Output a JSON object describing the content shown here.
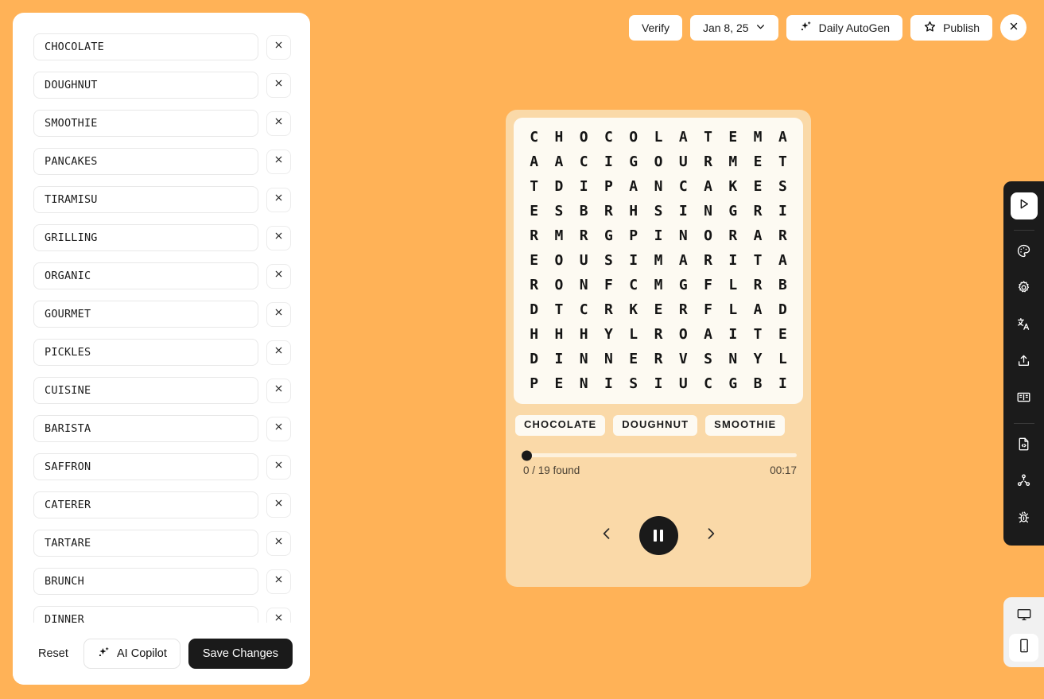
{
  "app": {
    "background_color": "#ffb257",
    "card_color": "#fad9a8",
    "panel_color": "#fdfaf2",
    "accent_dark": "#1a1a1a"
  },
  "toolbar": {
    "verify_label": "Verify",
    "date_label": "Jan 8, 25",
    "date_caret_icon": "chevron-down-icon",
    "autogen_label": "Daily AutoGen",
    "autogen_icon": "sparkle-icon",
    "publish_label": "Publish",
    "publish_icon": "star-icon",
    "close_icon": "close-icon"
  },
  "sidebar": {
    "words": [
      "CHOCOLATE",
      "DOUGHNUT",
      "SMOOTHIE",
      "PANCAKES",
      "TIRAMISU",
      "GRILLING",
      "ORGANIC",
      "GOURMET",
      "PICKLES",
      "CUISINE",
      "BARISTA",
      "SAFFRON",
      "CATERER",
      "TARTARE",
      "BRUNCH",
      "DINNER"
    ],
    "delete_icon": "close-icon",
    "footer": {
      "reset_label": "Reset",
      "copilot_label": "AI Copilot",
      "copilot_icon": "sparkle-icon",
      "save_label": "Save Changes"
    }
  },
  "puzzle": {
    "grid": [
      [
        "C",
        "H",
        "O",
        "C",
        "O",
        "L",
        "A",
        "T",
        "E",
        "M",
        "A"
      ],
      [
        "A",
        "A",
        "C",
        "I",
        "G",
        "O",
        "U",
        "R",
        "M",
        "E",
        "T"
      ],
      [
        "T",
        "D",
        "I",
        "P",
        "A",
        "N",
        "C",
        "A",
        "K",
        "E",
        "S"
      ],
      [
        "E",
        "S",
        "B",
        "R",
        "H",
        "S",
        "I",
        "N",
        "G",
        "R",
        "I"
      ],
      [
        "R",
        "M",
        "R",
        "G",
        "P",
        "I",
        "N",
        "O",
        "R",
        "A",
        "R"
      ],
      [
        "E",
        "O",
        "U",
        "S",
        "I",
        "M",
        "A",
        "R",
        "I",
        "T",
        "A"
      ],
      [
        "R",
        "O",
        "N",
        "F",
        "C",
        "M",
        "G",
        "F",
        "L",
        "R",
        "B"
      ],
      [
        "D",
        "T",
        "C",
        "R",
        "K",
        "E",
        "R",
        "F",
        "L",
        "A",
        "D"
      ],
      [
        "H",
        "H",
        "H",
        "Y",
        "L",
        "R",
        "O",
        "A",
        "I",
        "T",
        "E"
      ],
      [
        "D",
        "I",
        "N",
        "N",
        "E",
        "R",
        "V",
        "S",
        "N",
        "Y",
        "L"
      ],
      [
        "P",
        "E",
        "N",
        "I",
        "S",
        "I",
        "U",
        "C",
        "G",
        "B",
        "I"
      ]
    ],
    "chips": [
      "CHOCOLATE",
      "DOUGHNUT",
      "SMOOTHIE"
    ],
    "progress": {
      "percent": 0,
      "found_label": "0 / 19 found",
      "timer_label": "00:17"
    },
    "controls": {
      "prev_icon": "chevron-left-icon",
      "play_state_icon": "pause-icon",
      "next_icon": "chevron-right-icon"
    }
  },
  "rail": {
    "items": [
      {
        "icon": "play-icon",
        "active": true
      },
      {
        "icon": "palette-icon",
        "active": false
      },
      {
        "icon": "gear-icon",
        "active": false
      },
      {
        "icon": "translate-icon",
        "active": false
      },
      {
        "icon": "upload-icon",
        "active": false
      },
      {
        "icon": "book-icon",
        "active": false
      },
      {
        "icon": "file-code-icon",
        "active": false
      },
      {
        "icon": "share-network-icon",
        "active": false
      },
      {
        "icon": "bug-icon",
        "active": false
      }
    ]
  },
  "device_toggle": {
    "items": [
      {
        "icon": "desktop-icon",
        "active": false
      },
      {
        "icon": "mobile-icon",
        "active": true
      }
    ]
  }
}
